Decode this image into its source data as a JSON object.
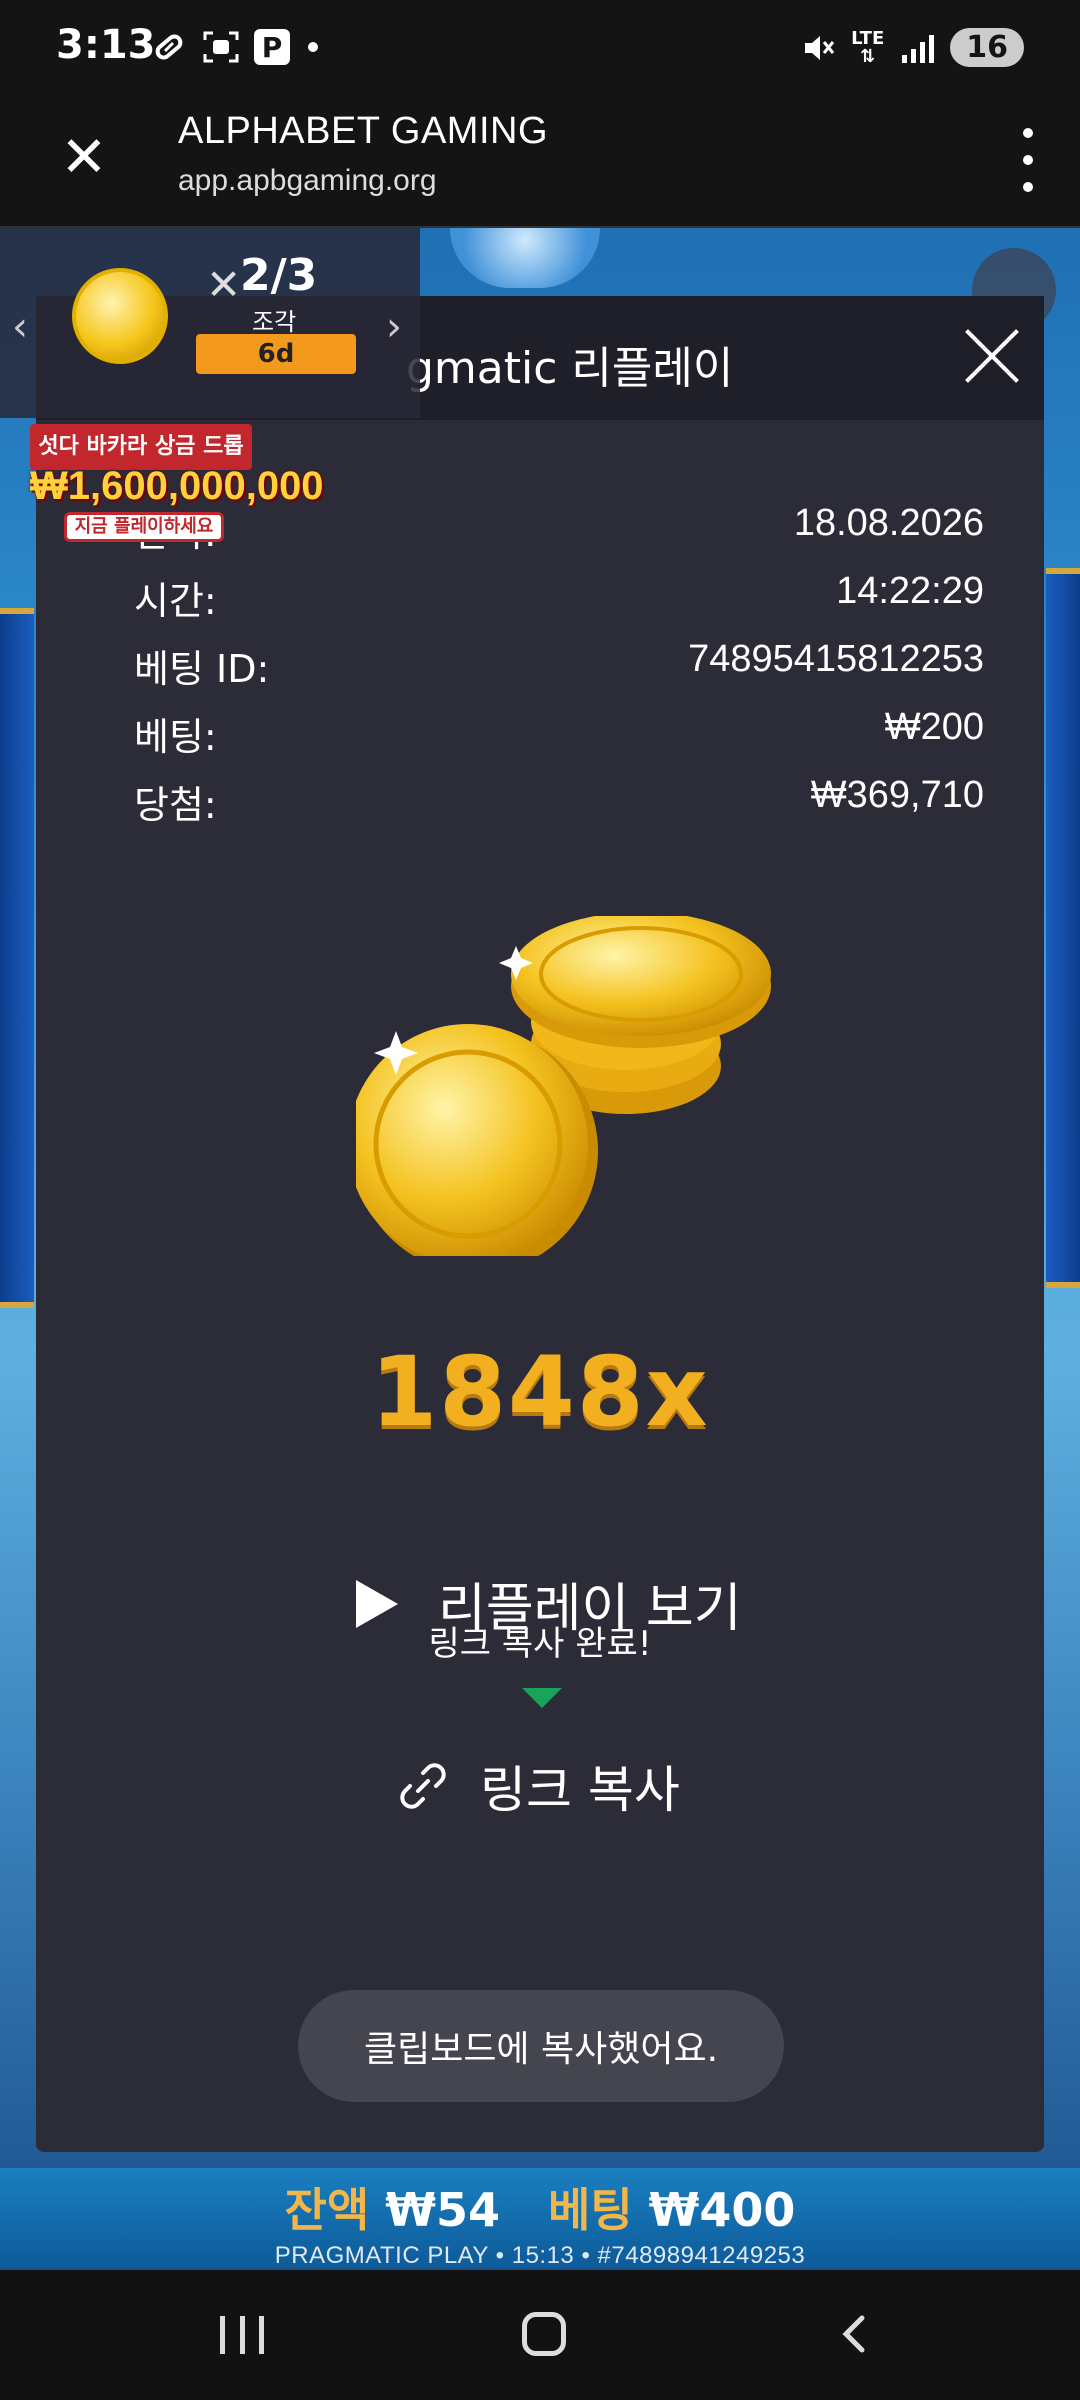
{
  "status_bar": {
    "time": "3:13",
    "left_icons": [
      "pill-icon",
      "screenshot-icon",
      "parking-icon",
      "dot-icon"
    ],
    "parking_letter": "P",
    "lte_top": "LTE",
    "battery": "16"
  },
  "browser": {
    "title": "ALPHABET GAMING",
    "url": "app.apbgaming.org"
  },
  "promo": {
    "fraction": "2/3",
    "piece_label": "조각",
    "days": "6d",
    "banner": "섯다 바카라 상금 드롭",
    "amount": "₩1,600,000,000",
    "cta": "지금 플레이하세요"
  },
  "panel": {
    "title": "Pragmatic 리플레이",
    "title_visible": "gmatic 리플레이",
    "info": [
      {
        "label": "날짜:",
        "value": "18.08.2026"
      },
      {
        "label": "시간:",
        "value": "14:22:29"
      },
      {
        "label": "베팅 ID:",
        "value": "74895415812253"
      },
      {
        "label": "베팅:",
        "value": "₩200"
      },
      {
        "label": "당첨:",
        "value": "₩369,710"
      }
    ],
    "multiplier": "1848x",
    "replay_label": "리플레이 보기",
    "tooltip": "링크 복사 완료!",
    "copy_label": "링크 복사",
    "toast": "클립보드에 복사했어요."
  },
  "game_bar": {
    "balance_label": "잔액",
    "balance_value": "₩54",
    "bet_label": "베팅",
    "bet_value": "₩400",
    "sub": "PRAGMATIC PLAY • 15:13 • #74898941249253"
  },
  "colors": {
    "panel_bg": "#2c2c38",
    "multiplier": "#f2b021",
    "tooltip_arrow": "#19a35b",
    "promo_days": "#f39a1c"
  }
}
